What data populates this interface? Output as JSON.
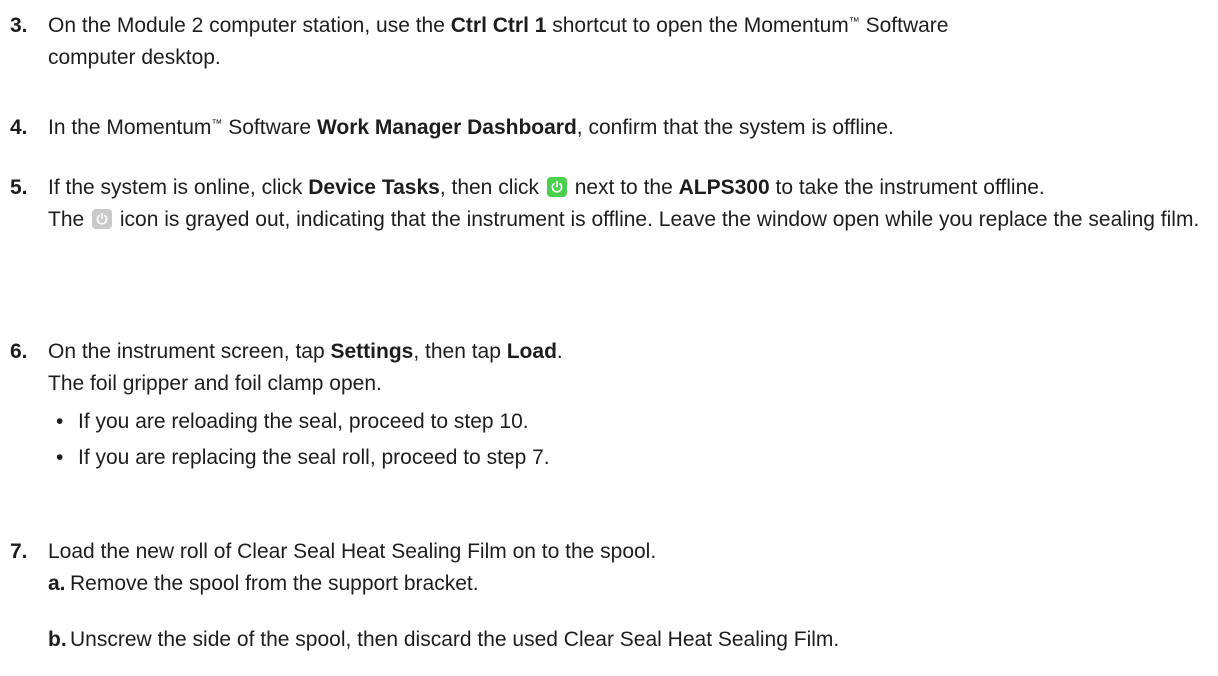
{
  "steps": {
    "s3": {
      "number": "3.",
      "t1": "On the Module 2 computer station, use the ",
      "b1": "Ctrl Ctrl 1",
      "t2": " shortcut to open the Momentum",
      "tm": "™",
      "t3": " Software",
      "t4": "computer desktop."
    },
    "s4": {
      "number": "4.",
      "t1": "In the Momentum",
      "tm": "™",
      "t2": " Software ",
      "b1": "Work Manager Dashboard",
      "t3": ", confirm that the system is offline."
    },
    "s5": {
      "number": "5.",
      "t1": "If the system is online, click ",
      "b1": "Device Tasks",
      "t2": ", then click ",
      "t3": " next to the ",
      "b2": "ALPS300",
      "t4": " to take the instrument offline.",
      "f1": "The ",
      "f2": " icon is grayed out, indicating that the instrument is offline. Leave the window open while you replace the sealing film."
    },
    "s6": {
      "number": "6.",
      "t1": "On the instrument screen, tap ",
      "b1": "Settings",
      "t2": ", then tap ",
      "b2": "Load",
      "t3": ".",
      "f1": "The foil gripper and foil clamp open.",
      "bullets": [
        "If you are reloading the seal, proceed to step 10.",
        "If you are replacing the seal roll, proceed to step 7."
      ]
    },
    "s7": {
      "number": "7.",
      "t1": "Load the new roll of Clear Seal Heat Sealing Film on to the spool.",
      "subs": [
        {
          "letter": "a.",
          "text": "Remove the spool from the support bracket."
        },
        {
          "letter": "b.",
          "text": "Unscrew the side of the spool, then discard the used Clear Seal Heat Sealing Film."
        }
      ]
    }
  },
  "colors": {
    "power_icon_active": "#4ccf4c",
    "power_icon_inactive": "#c9c9c9",
    "text": "#1d1d1d"
  },
  "icons": {
    "active": "power-icon",
    "inactive": "power-icon"
  }
}
